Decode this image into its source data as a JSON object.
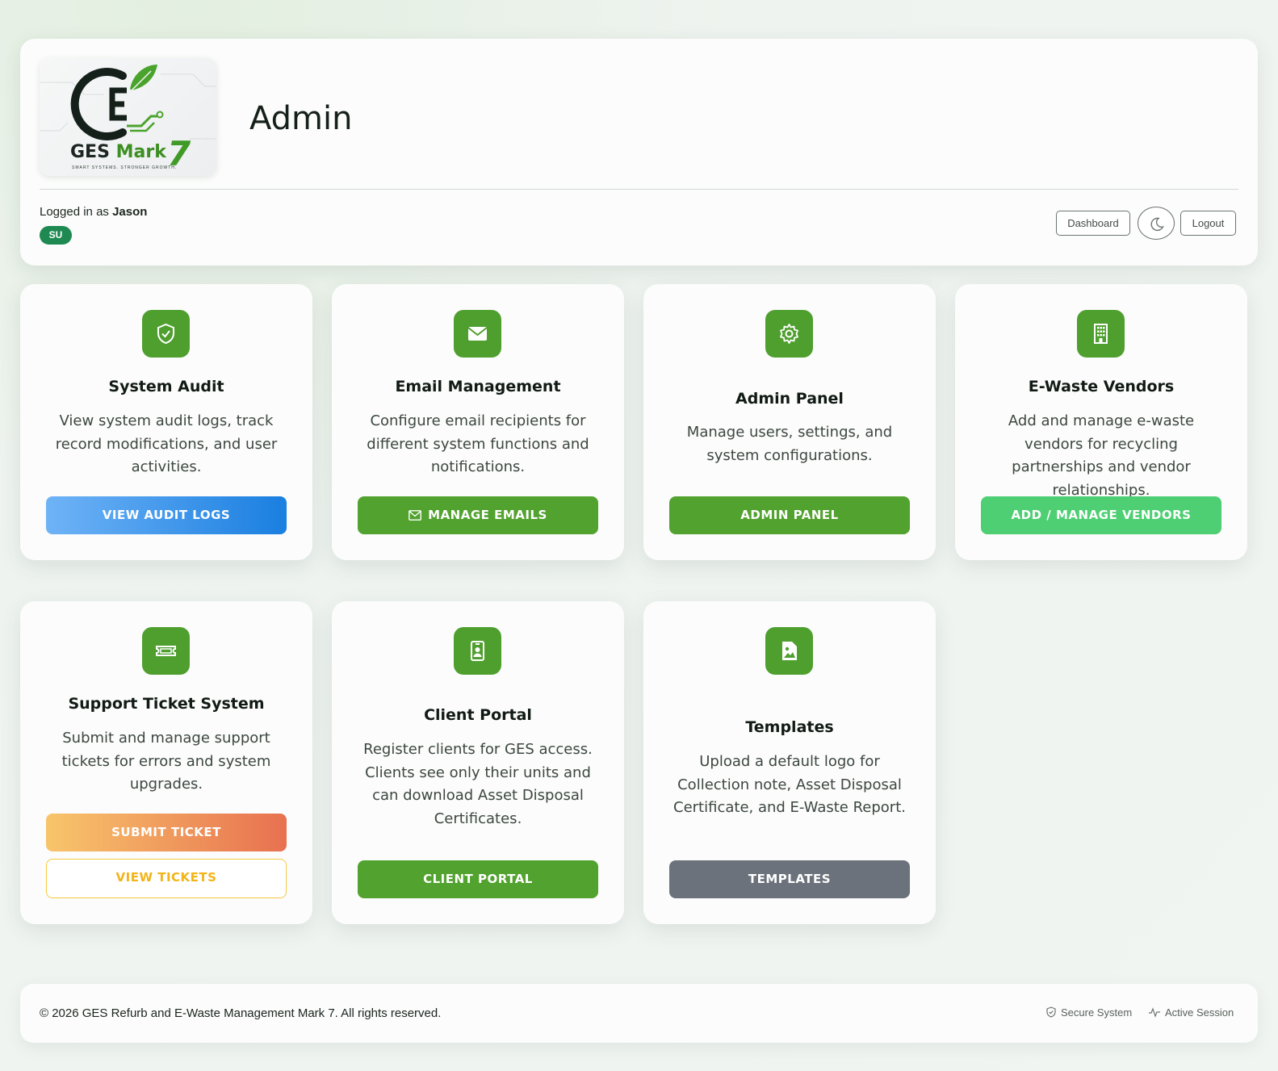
{
  "header": {
    "logo": {
      "brand": "GES",
      "mark": "Mark",
      "version": "7",
      "tagline": "SMART SYSTEMS. STRONGER GROWTH."
    },
    "title": "Admin",
    "logged_in_prefix": "Logged in as",
    "username": "Jason",
    "role_badge": "SU",
    "buttons": {
      "dashboard": "Dashboard",
      "theme_icon": "moon-icon",
      "logout": "Logout"
    }
  },
  "cards": [
    {
      "icon": "shield-check-icon",
      "title": "System Audit",
      "description": "View system audit logs, track record modifications, and user activities.",
      "button": "VIEW AUDIT LOGS"
    },
    {
      "icon": "envelope-icon",
      "title": "Email Management",
      "description": "Configure email recipients for different system functions and notifications.",
      "button": "MANAGE EMAILS"
    },
    {
      "icon": "gear-icon",
      "title": "Admin Panel",
      "description": "Manage users, settings, and system configurations.",
      "button": "ADMIN PANEL"
    },
    {
      "icon": "building-icon",
      "title": "E-Waste Vendors",
      "description": "Add and manage e-waste vendors for recycling partnerships and vendor relationships.",
      "button": "ADD / MANAGE VENDORS"
    },
    {
      "icon": "ticket-icon",
      "title": "Support Ticket System",
      "description": "Submit and manage support tickets for errors and system upgrades.",
      "button": "SUBMIT TICKET",
      "button2": "VIEW TICKETS"
    },
    {
      "icon": "id-badge-icon",
      "title": "Client Portal",
      "description": "Register clients for GES access. Clients see only their units and can download Asset Disposal Certificates.",
      "button": "CLIENT PORTAL"
    },
    {
      "icon": "image-file-icon",
      "title": "Templates",
      "description": "Upload a default logo for Collection note, Asset Disposal Certificate, and E-Waste Report.",
      "button": "TEMPLATES"
    }
  ],
  "footer": {
    "copyright": "© 2026 GES Refurb and E-Waste Management Mark 7. All rights reserved.",
    "status_secure": "Secure System",
    "status_active": "Active Session"
  },
  "colors": {
    "brand_green": "#4f9f2f",
    "badge_green": "#1e8a52",
    "audit_blue": "#1a7fe0",
    "vendor_green": "#4ecf73",
    "ticket_orange": "#e87150",
    "ticket_yellow": "#f2b418",
    "templates_gray": "#6b727b"
  }
}
